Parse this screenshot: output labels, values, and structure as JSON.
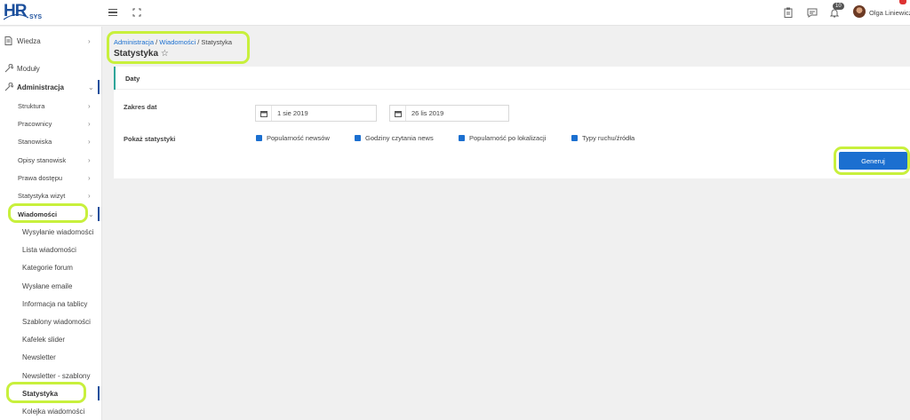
{
  "brand": {
    "logo_main": "HR",
    "logo_sub": "SYS"
  },
  "topbar": {
    "notifications_count": "10",
    "user_name": "Olga Liniewicz"
  },
  "icons": {
    "menu": "hamburger-icon",
    "fullscreen": "fullscreen-icon",
    "clipboard": "clipboard-icon",
    "chat": "chat-icon",
    "bell": "bell-icon"
  },
  "sidebar": {
    "items": [
      {
        "label": "Wiedza"
      },
      {
        "label": "Moduły"
      },
      {
        "label": "Administracja"
      }
    ],
    "admin_children": [
      {
        "label": "Struktura"
      },
      {
        "label": "Pracownicy"
      },
      {
        "label": "Stanowiska"
      },
      {
        "label": "Opisy stanowisk"
      },
      {
        "label": "Prawa dostępu"
      },
      {
        "label": "Statystyka wizyt"
      },
      {
        "label": "Wiadomości"
      }
    ],
    "messages_children": [
      {
        "label": "Wysyłanie wiadomości"
      },
      {
        "label": "Lista wiadomości"
      },
      {
        "label": "Kategorie forum"
      },
      {
        "label": "Wysłane emaile"
      },
      {
        "label": "Informacja na tablicy"
      },
      {
        "label": "Szablony wiadomości"
      },
      {
        "label": "Kafelek slider"
      },
      {
        "label": "Newsletter"
      },
      {
        "label": "Newsletter - szablony"
      },
      {
        "label": "Statystyka"
      },
      {
        "label": "Kolejka wiadomości"
      }
    ]
  },
  "breadcrumb": {
    "part1": "Administracja",
    "sep": " / ",
    "part2": "Wiadomości",
    "part3": "Statystyka"
  },
  "page_title": "Statystyka",
  "card": {
    "tab_label": "Daty",
    "date_range_label": "Zakres dat",
    "date_from": "1 sie 2019",
    "date_to": "26 lis 2019",
    "show_stats_label": "Pokaż statystyki",
    "options": [
      {
        "label": "Popularność newsów"
      },
      {
        "label": "Godziny czytania news"
      },
      {
        "label": "Popularność po lokalizacji"
      },
      {
        "label": "Typy ruchu/źródła"
      }
    ],
    "generate_label": "Generuj"
  },
  "colors": {
    "primary": "#1b6fd0",
    "brand": "#1b4f9c",
    "highlight": "#c8f03c",
    "tab_accent": "#2fa59a"
  }
}
